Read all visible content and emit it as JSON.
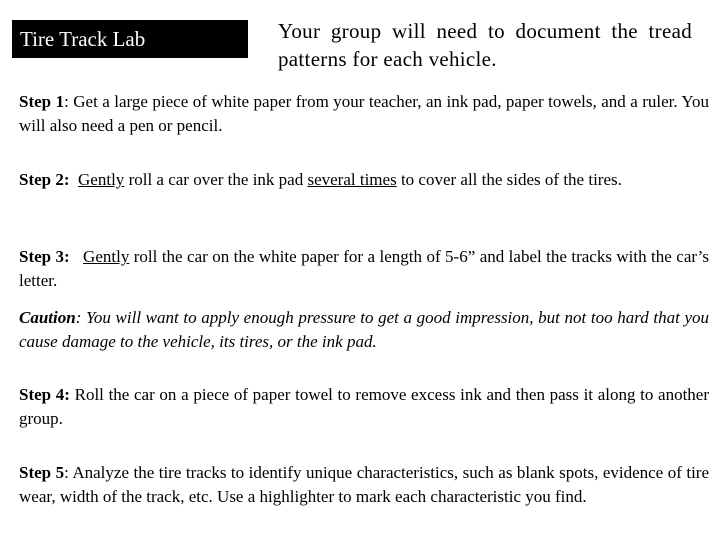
{
  "title": "Tire Track Lab",
  "intro": "Your group will need to document the tread patterns for each vehicle.",
  "steps": [
    {
      "label": "Step 1",
      "sep": ":",
      "text": "  Get a large piece of white paper from your teacher, an ink pad, paper towels, and a ruler. You will also need a pen or pencil."
    },
    {
      "label": "Step 2:",
      "pre": "  ",
      "u1": "Gently",
      "mid": " roll a car over the ink pad ",
      "u2": "several times",
      "post": " to cover all the sides of the tires."
    },
    {
      "label": "Step 3:",
      "pre": "   ",
      "u1": "Gently",
      "post": " roll the car on the white paper for a length of 5-6” and label the tracks with the car’s letter."
    },
    {
      "label": "Step 4:",
      "text": " Roll the car on a piece of paper towel to remove excess ink and then pass it along to another group."
    },
    {
      "label": "Step 5",
      "sep": ":",
      "text": "  Analyze the tire tracks to identify unique characteristics, such as blank spots, evidence of tire wear, width of the track, etc. Use a highlighter to mark each characteristic you find."
    }
  ],
  "caution": {
    "label": "Caution",
    "text": ": You will want to apply enough pressure to get a good impression, but not too hard that you cause damage to the vehicle, its tires, or the ink pad."
  }
}
